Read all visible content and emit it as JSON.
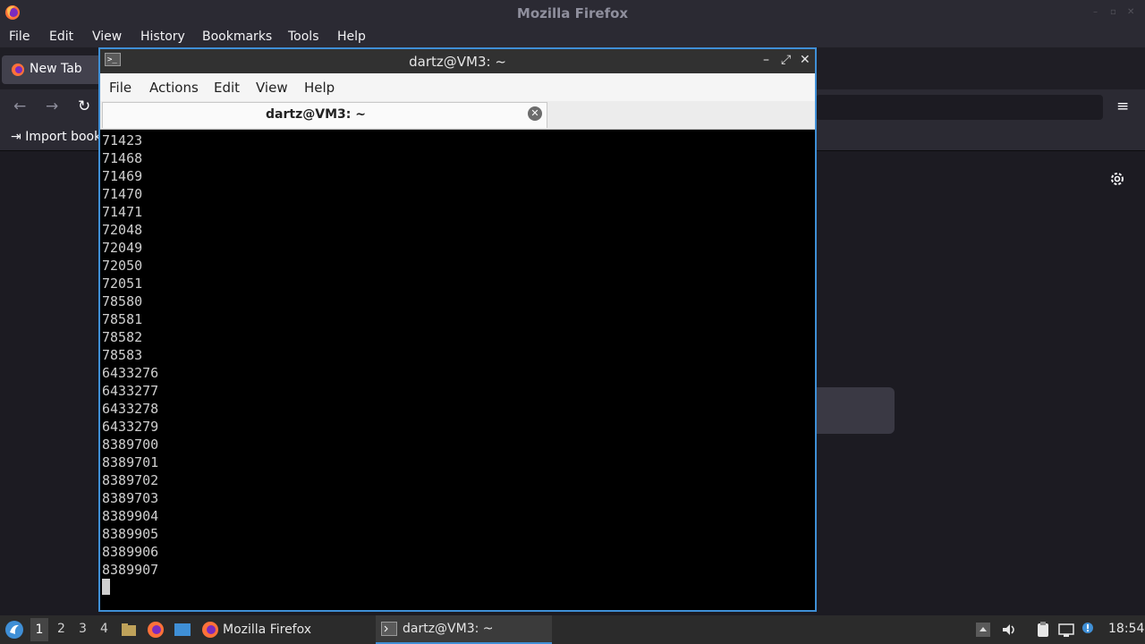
{
  "firefox": {
    "title": "Mozilla Firefox",
    "menu": [
      "File",
      "Edit",
      "View",
      "History",
      "Bookmarks",
      "Tools",
      "Help"
    ],
    "tab_label": "New Tab",
    "import_bookmarks": "Import book"
  },
  "terminal": {
    "title": "dartz@VM3: ~",
    "menu": [
      "File",
      "Actions",
      "Edit",
      "View",
      "Help"
    ],
    "tab_label": "dartz@VM3: ~",
    "output_lines": [
      "71423",
      "71468",
      "71469",
      "71470",
      "71471",
      "72048",
      "72049",
      "72050",
      "72051",
      "78580",
      "78581",
      "78582",
      "78583",
      "6433276",
      "6433277",
      "6433278",
      "6433279",
      "8389700",
      "8389701",
      "8389702",
      "8389703",
      "8389904",
      "8389905",
      "8389906",
      "8389907"
    ]
  },
  "taskbar": {
    "workspaces": [
      "1",
      "2",
      "3",
      "4"
    ],
    "active_workspace": "1",
    "tasks": [
      {
        "label": "Mozilla Firefox",
        "icon": "firefox-icon"
      },
      {
        "label": "dartz@VM3: ~",
        "icon": "terminal-icon",
        "active": true
      }
    ],
    "clock": "18:54"
  },
  "colors": {
    "accent": "#3f8fd6",
    "firefox_bg": "#1c1b22",
    "terminal_bg": "#000000"
  }
}
